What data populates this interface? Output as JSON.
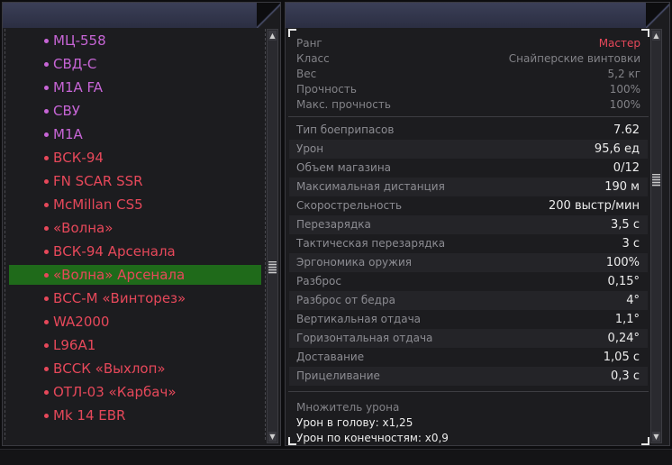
{
  "weapon_list": [
    {
      "name": "МЦ-558",
      "color": "purple"
    },
    {
      "name": "СВД-С",
      "color": "purple"
    },
    {
      "name": "M1A FA",
      "color": "purple"
    },
    {
      "name": "СВУ",
      "color": "purple"
    },
    {
      "name": "M1A",
      "color": "purple"
    },
    {
      "name": "ВСК-94",
      "color": "red"
    },
    {
      "name": "FN SCAR SSR",
      "color": "red"
    },
    {
      "name": "McMillan CS5",
      "color": "red"
    },
    {
      "name": "«Волна»",
      "color": "red"
    },
    {
      "name": "ВСК-94 Арсенала",
      "color": "red"
    },
    {
      "name": "«Волна» Арсенала",
      "color": "red",
      "selected": true
    },
    {
      "name": "ВСС-М «Винторез»",
      "color": "red"
    },
    {
      "name": "WA2000",
      "color": "red"
    },
    {
      "name": "L96A1",
      "color": "red"
    },
    {
      "name": "ВССК «Выхлоп»",
      "color": "red"
    },
    {
      "name": "ОТЛ-03 «Карбач»",
      "color": "red"
    },
    {
      "name": "Mk 14 EBR",
      "color": "red"
    }
  ],
  "colors": {
    "purple_item": "#c765d6",
    "red_item": "#e6485a",
    "selected_row": "#1f6a1a",
    "header": "#3b3f57"
  },
  "info": {
    "rank": {
      "label": "Ранг",
      "value": "Мастер"
    },
    "class": {
      "label": "Класс",
      "value": "Снайперские винтовки"
    },
    "weight": {
      "label": "Вес",
      "value": "5,2 кг"
    },
    "durability": {
      "label": "Прочность",
      "value": "100%"
    },
    "max_durability": {
      "label": "Макс. прочность",
      "value": "100%"
    }
  },
  "stats": [
    {
      "label": "Тип боеприпасов",
      "value": "7.62"
    },
    {
      "label": "Урон",
      "value": "95,6 ед"
    },
    {
      "label": "Объем магазина",
      "value": "0/12"
    },
    {
      "label": "Максимальная дистанция",
      "value": "190 м"
    },
    {
      "label": "Скорострельность",
      "value": "200 выстр/мин"
    },
    {
      "label": "Перезарядка",
      "value": "3,5 с"
    },
    {
      "label": "Тактическая перезарядка",
      "value": "3 с"
    },
    {
      "label": "Эргономика оружия",
      "value": "100%"
    },
    {
      "label": "Разброс",
      "value": "0,15°"
    },
    {
      "label": "Разброс от бедра",
      "value": "4°"
    },
    {
      "label": "Вертикальная отдача",
      "value": "1,1°"
    },
    {
      "label": "Горизонтальная отдача",
      "value": "0,24°"
    },
    {
      "label": "Доставание",
      "value": "1,05 с"
    },
    {
      "label": "Прицеливание",
      "value": "0,3 с"
    }
  ],
  "damage_multiplier": {
    "title": "Множитель урона",
    "head": "Урон в голову: x1,25",
    "limbs": "Урон по конечностям: x0,9"
  },
  "icons": {
    "scroll_up": "▲",
    "scroll_down": "▼"
  }
}
